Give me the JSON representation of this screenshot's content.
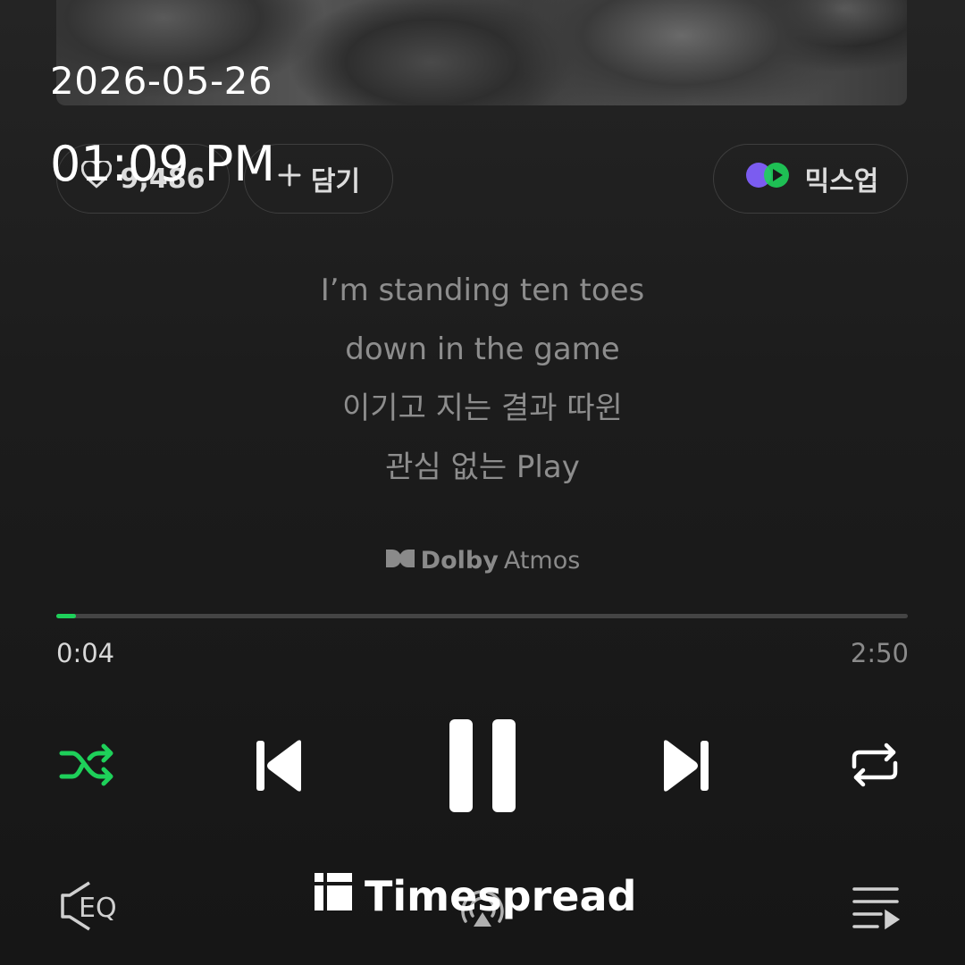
{
  "overlay": {
    "date": "2026-05-26",
    "time": "01:09 PM"
  },
  "actions": {
    "like_count": "9,486",
    "add_label": "담기",
    "mixup_label": "믹스업"
  },
  "lyrics": [
    "I’m standing ten toes",
    "down in the game",
    "이기고 지는 결과 따윈",
    "관심 없는 Play"
  ],
  "badge": {
    "brand": "Dolby",
    "product": "Atmos"
  },
  "playback": {
    "elapsed": "0:04",
    "duration": "2:50",
    "progress_fraction": 0.0235,
    "accent_color": "#1ed05a"
  },
  "bottom": {
    "eq_label": "EQ"
  },
  "watermark": {
    "text": "Timespread"
  },
  "icons": {
    "shuffle": "shuffle-icon",
    "previous": "skip-previous-icon",
    "pause": "pause-icon",
    "next": "skip-next-icon",
    "repeat": "repeat-icon",
    "cast": "cast-icon",
    "playlist": "playlist-icon"
  }
}
